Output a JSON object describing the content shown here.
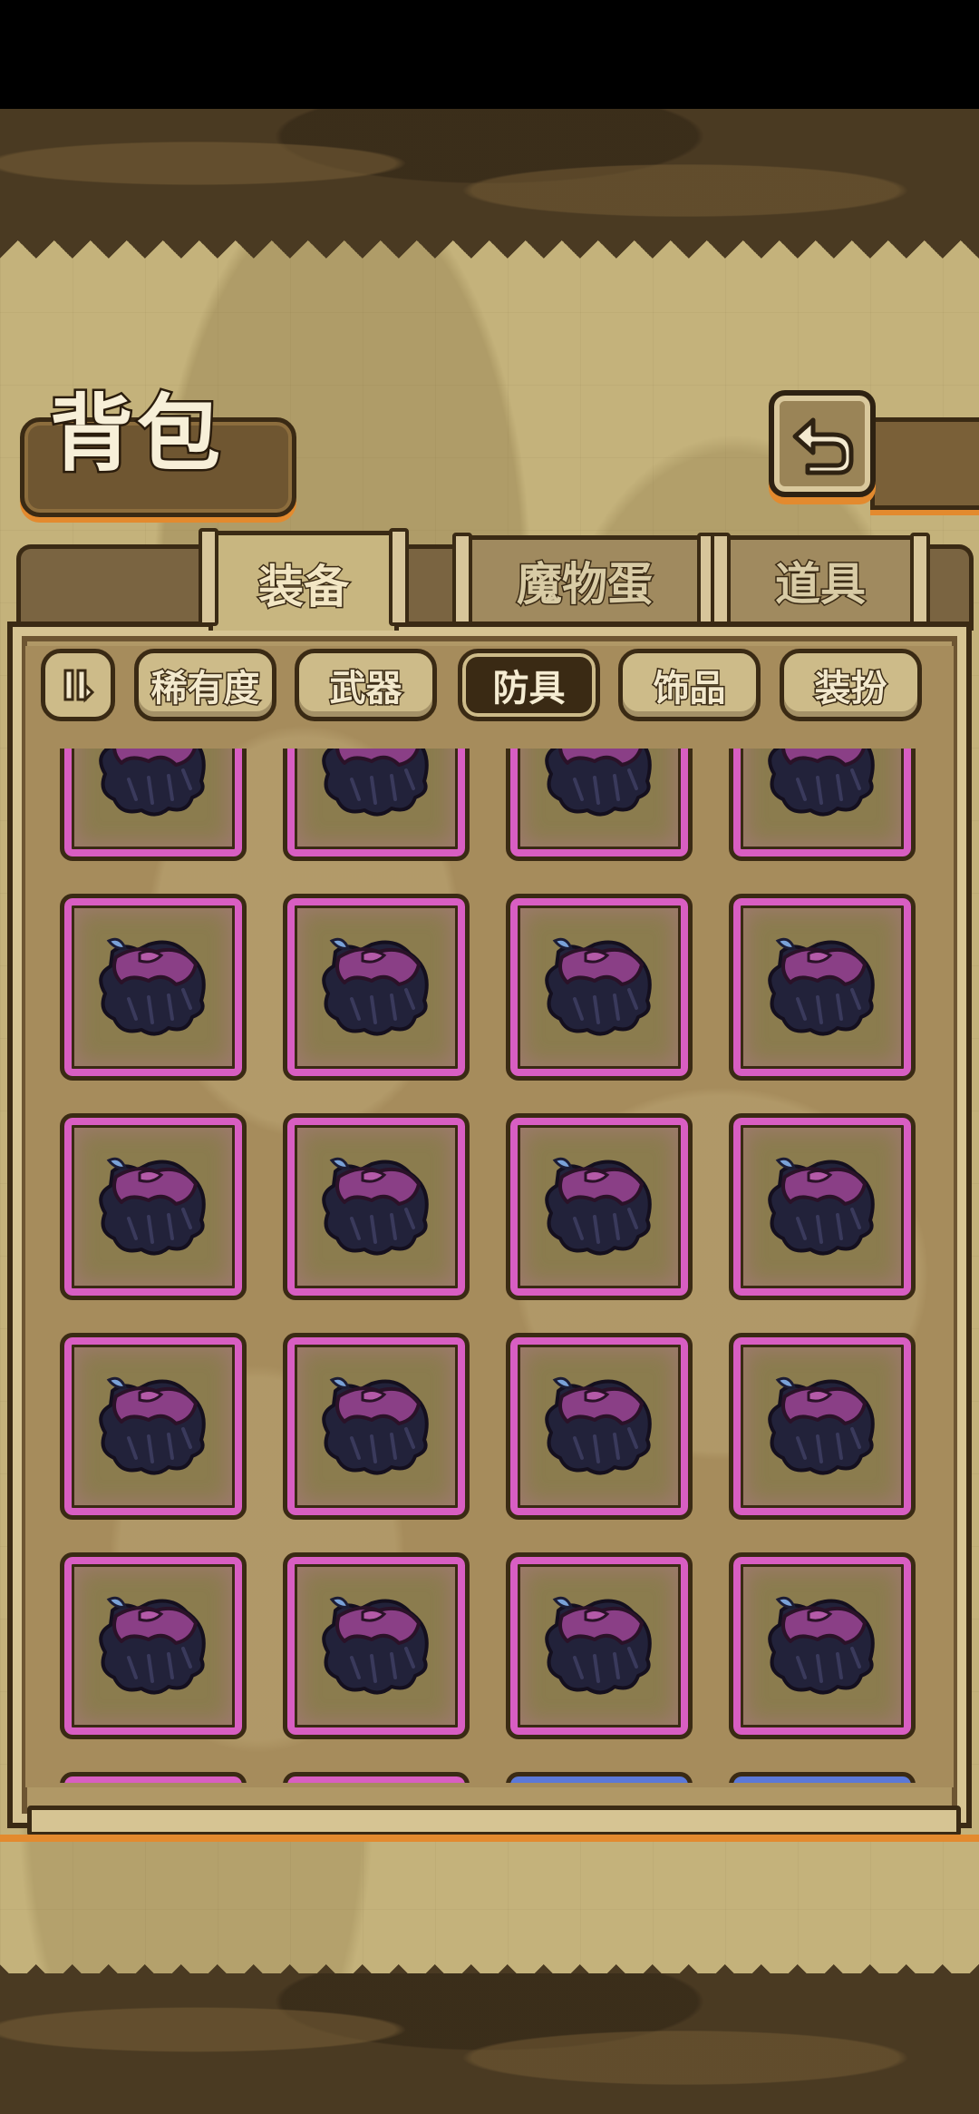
{
  "header": {
    "title": "背包",
    "back_icon": "return-arrow-icon"
  },
  "tabs": [
    {
      "label": "装备",
      "active": true
    },
    {
      "label": "魔物蛋",
      "active": false
    },
    {
      "label": "道具",
      "active": false
    }
  ],
  "filters": {
    "sort_icon": "sort-toggle-icon",
    "items": [
      {
        "label": "稀有度",
        "active": false
      },
      {
        "label": "武器",
        "active": false
      },
      {
        "label": "防具",
        "active": true
      },
      {
        "label": "饰品",
        "active": false
      },
      {
        "label": "装扮",
        "active": false
      }
    ]
  },
  "inventory": {
    "item_icon": "purple-cloak-icon",
    "rarity_colors": {
      "epic": "#d85ec2",
      "rare": "#5b78d8"
    },
    "rows": [
      [
        "epic",
        "epic",
        "epic",
        "epic"
      ],
      [
        "epic",
        "epic",
        "epic",
        "epic"
      ],
      [
        "epic",
        "epic",
        "epic",
        "epic"
      ],
      [
        "epic",
        "epic",
        "epic",
        "epic"
      ],
      [
        "epic",
        "epic",
        "epic",
        "epic"
      ],
      [
        "epic",
        "epic",
        "rare",
        "rare"
      ]
    ]
  }
}
